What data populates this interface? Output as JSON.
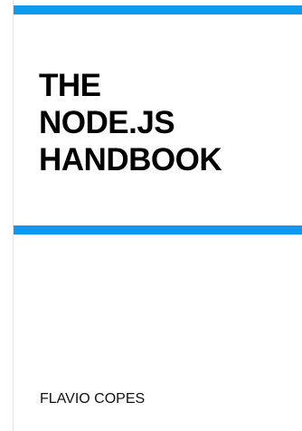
{
  "cover": {
    "title_lines": [
      "THE",
      "NODE.JS",
      "HANDBOOK"
    ],
    "author": "FLAVIO COPES"
  },
  "colors": {
    "accent_band": "#0d9bf0",
    "background": "#ffffff",
    "text": "#000000"
  }
}
